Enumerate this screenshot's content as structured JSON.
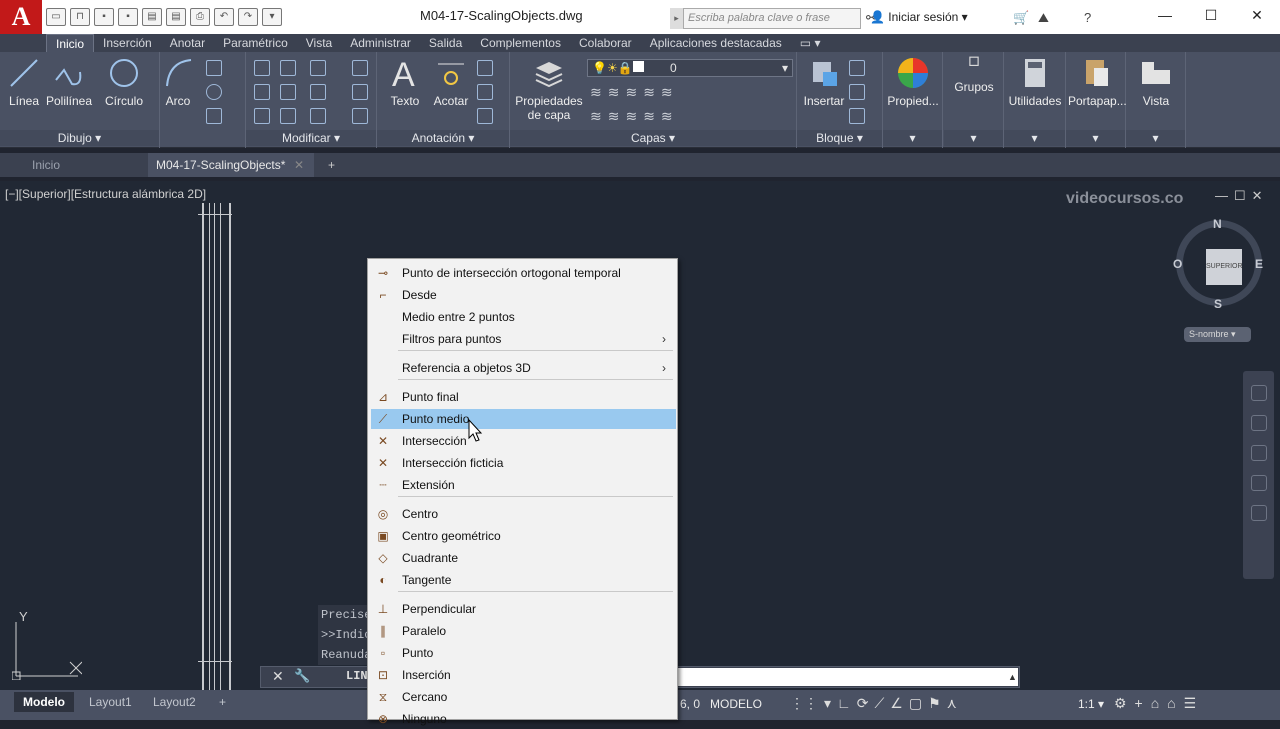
{
  "app": {
    "logo": "A",
    "doc_title": "M04-17-ScalingObjects.dwg",
    "search_placeholder": "Escriba palabra clave o frase",
    "signin": "Iniciar sesión"
  },
  "ribbon_tabs": [
    {
      "label": "Inicio",
      "active": true
    },
    {
      "label": "Inserción"
    },
    {
      "label": "Anotar"
    },
    {
      "label": "Paramétrico"
    },
    {
      "label": "Vista"
    },
    {
      "label": "Administrar"
    },
    {
      "label": "Salida"
    },
    {
      "label": "Complementos"
    },
    {
      "label": "Colaborar"
    },
    {
      "label": "Aplicaciones destacadas"
    }
  ],
  "ribbon": {
    "draw": {
      "linea": "Línea",
      "polilinea": "Polilínea",
      "circulo": "Círculo",
      "arco": "Arco",
      "label": "Dibujo ▾"
    },
    "modify": {
      "label": "Modificar ▾"
    },
    "annotation": {
      "texto": "Texto",
      "acotar": "Acotar",
      "label": "Anotación ▾"
    },
    "layers": {
      "props_line1": "Propiedades",
      "props_line2": "de capa",
      "current_layer": "0",
      "label": "Capas ▾"
    },
    "block": {
      "insertar": "Insertar",
      "label": "Bloque ▾"
    },
    "extra": {
      "propied": "Propied...",
      "grupos": "Grupos",
      "utilidades": "Utilidades",
      "portapap": "Portapap...",
      "vista": "Vista"
    }
  },
  "doc_tabs": {
    "home": "Inicio",
    "active": "M04-17-ScalingObjects*"
  },
  "viewport": {
    "view_label": "[−][Superior][Estructura alámbrica 2D]",
    "watermark": "videocursos.co",
    "cube_face": "SUPERIOR",
    "compass": {
      "n": "N",
      "s": "S",
      "e": "E",
      "o": "O"
    },
    "wcs": "S-nombre",
    "ucs_y": "Y"
  },
  "command": {
    "history": [
      "Precise",
      ">>Indic",
      "Reanuda"
    ],
    "prefix": "LIN"
  },
  "menu": {
    "items": [
      {
        "label": "Punto de intersección ortogonal temporal",
        "icon": "⊸"
      },
      {
        "label": "Desde",
        "icon": "⌐"
      },
      {
        "label": "Medio entre 2 puntos",
        "icon": ""
      },
      {
        "label": "Filtros para puntos",
        "icon": "",
        "sub": "›"
      },
      {
        "label": "Referencia a objetos 3D",
        "icon": "",
        "sub": "›"
      },
      {
        "label": "Punto final",
        "icon": "⊿"
      },
      {
        "label": "Punto medio",
        "icon": "⟋"
      },
      {
        "label": "Intersección",
        "icon": "✕"
      },
      {
        "label": "Intersección ficticia",
        "icon": "✕"
      },
      {
        "label": "Extensión",
        "icon": "┈"
      },
      {
        "label": "Centro",
        "icon": "◎"
      },
      {
        "label": "Centro geométrico",
        "icon": "▣"
      },
      {
        "label": "Cuadrante",
        "icon": "◇"
      },
      {
        "label": "Tangente",
        "icon": "◐"
      },
      {
        "label": "Perpendicular",
        "icon": "⊥"
      },
      {
        "label": "Paralelo",
        "icon": "∥"
      },
      {
        "label": "Punto",
        "icon": "▫"
      },
      {
        "label": "Inserción",
        "icon": "⊡"
      },
      {
        "label": "Cercano",
        "icon": "⧖"
      },
      {
        "label": "Ninguno",
        "icon": "⊗"
      }
    ]
  },
  "status": {
    "modelo": "Modelo",
    "layout1": "Layout1",
    "layout2": "Layout2",
    "coords": "6, 0",
    "mode": "MODELO",
    "scale": "1:1"
  }
}
